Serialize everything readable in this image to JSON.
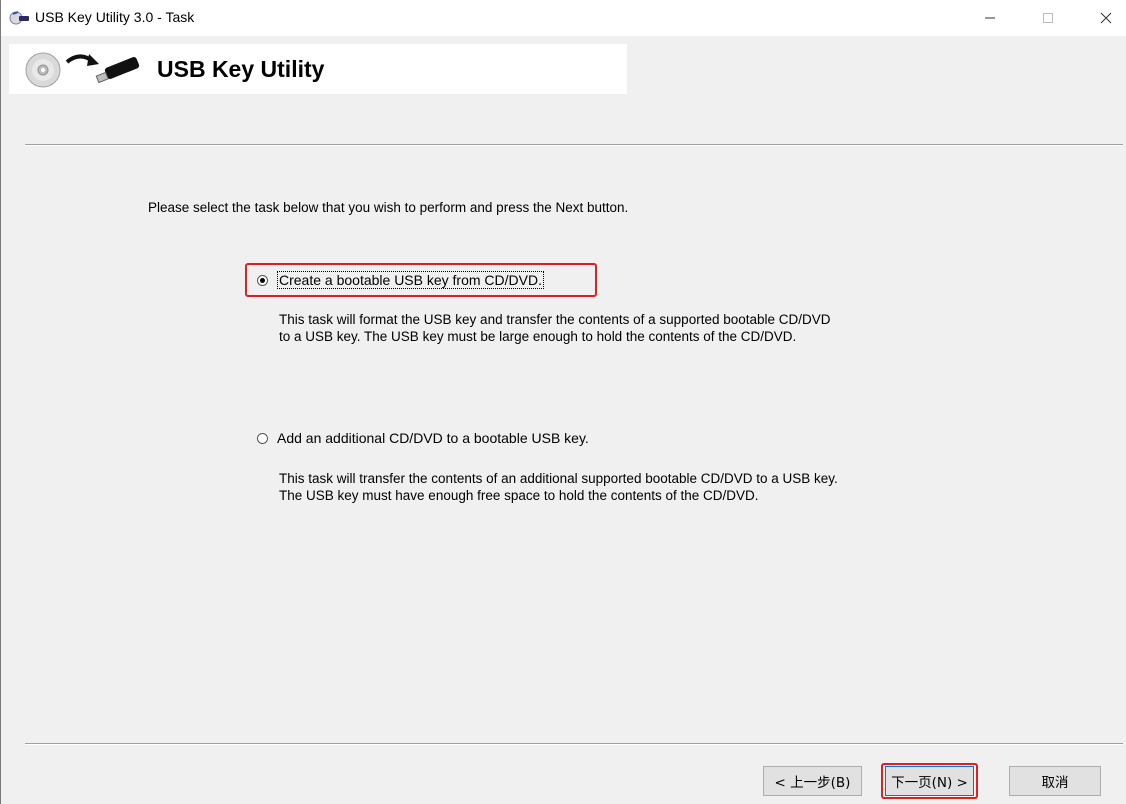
{
  "window": {
    "title": "USB Key Utility 3.0 - Task"
  },
  "banner": {
    "title": "USB Key Utility"
  },
  "main": {
    "prompt": "Please select the task below that you wish to perform and press the Next button.",
    "options": [
      {
        "label": "Create a bootable USB key from CD/DVD.",
        "selected": true,
        "description": "This task will format the USB key and transfer the contents of a supported bootable CD/DVD to a USB key.  The USB key must be large enough to hold the contents of the CD/DVD."
      },
      {
        "label": "Add an additional CD/DVD to a bootable USB key.",
        "selected": false,
        "description": "This task will transfer the contents of an additional supported bootable CD/DVD to a USB key.  The USB key must have enough free space to hold the contents of the CD/DVD."
      }
    ]
  },
  "footer": {
    "back_label": "< 上一步(B)",
    "next_label": "下一页(N) >",
    "cancel_label": "取消"
  },
  "colors": {
    "highlight": "#e02020",
    "background": "#f0f0f0"
  },
  "icons": [
    "app-icon",
    "minimize-icon",
    "maximize-icon",
    "close-icon",
    "cd-icon",
    "usb-drive-icon"
  ]
}
